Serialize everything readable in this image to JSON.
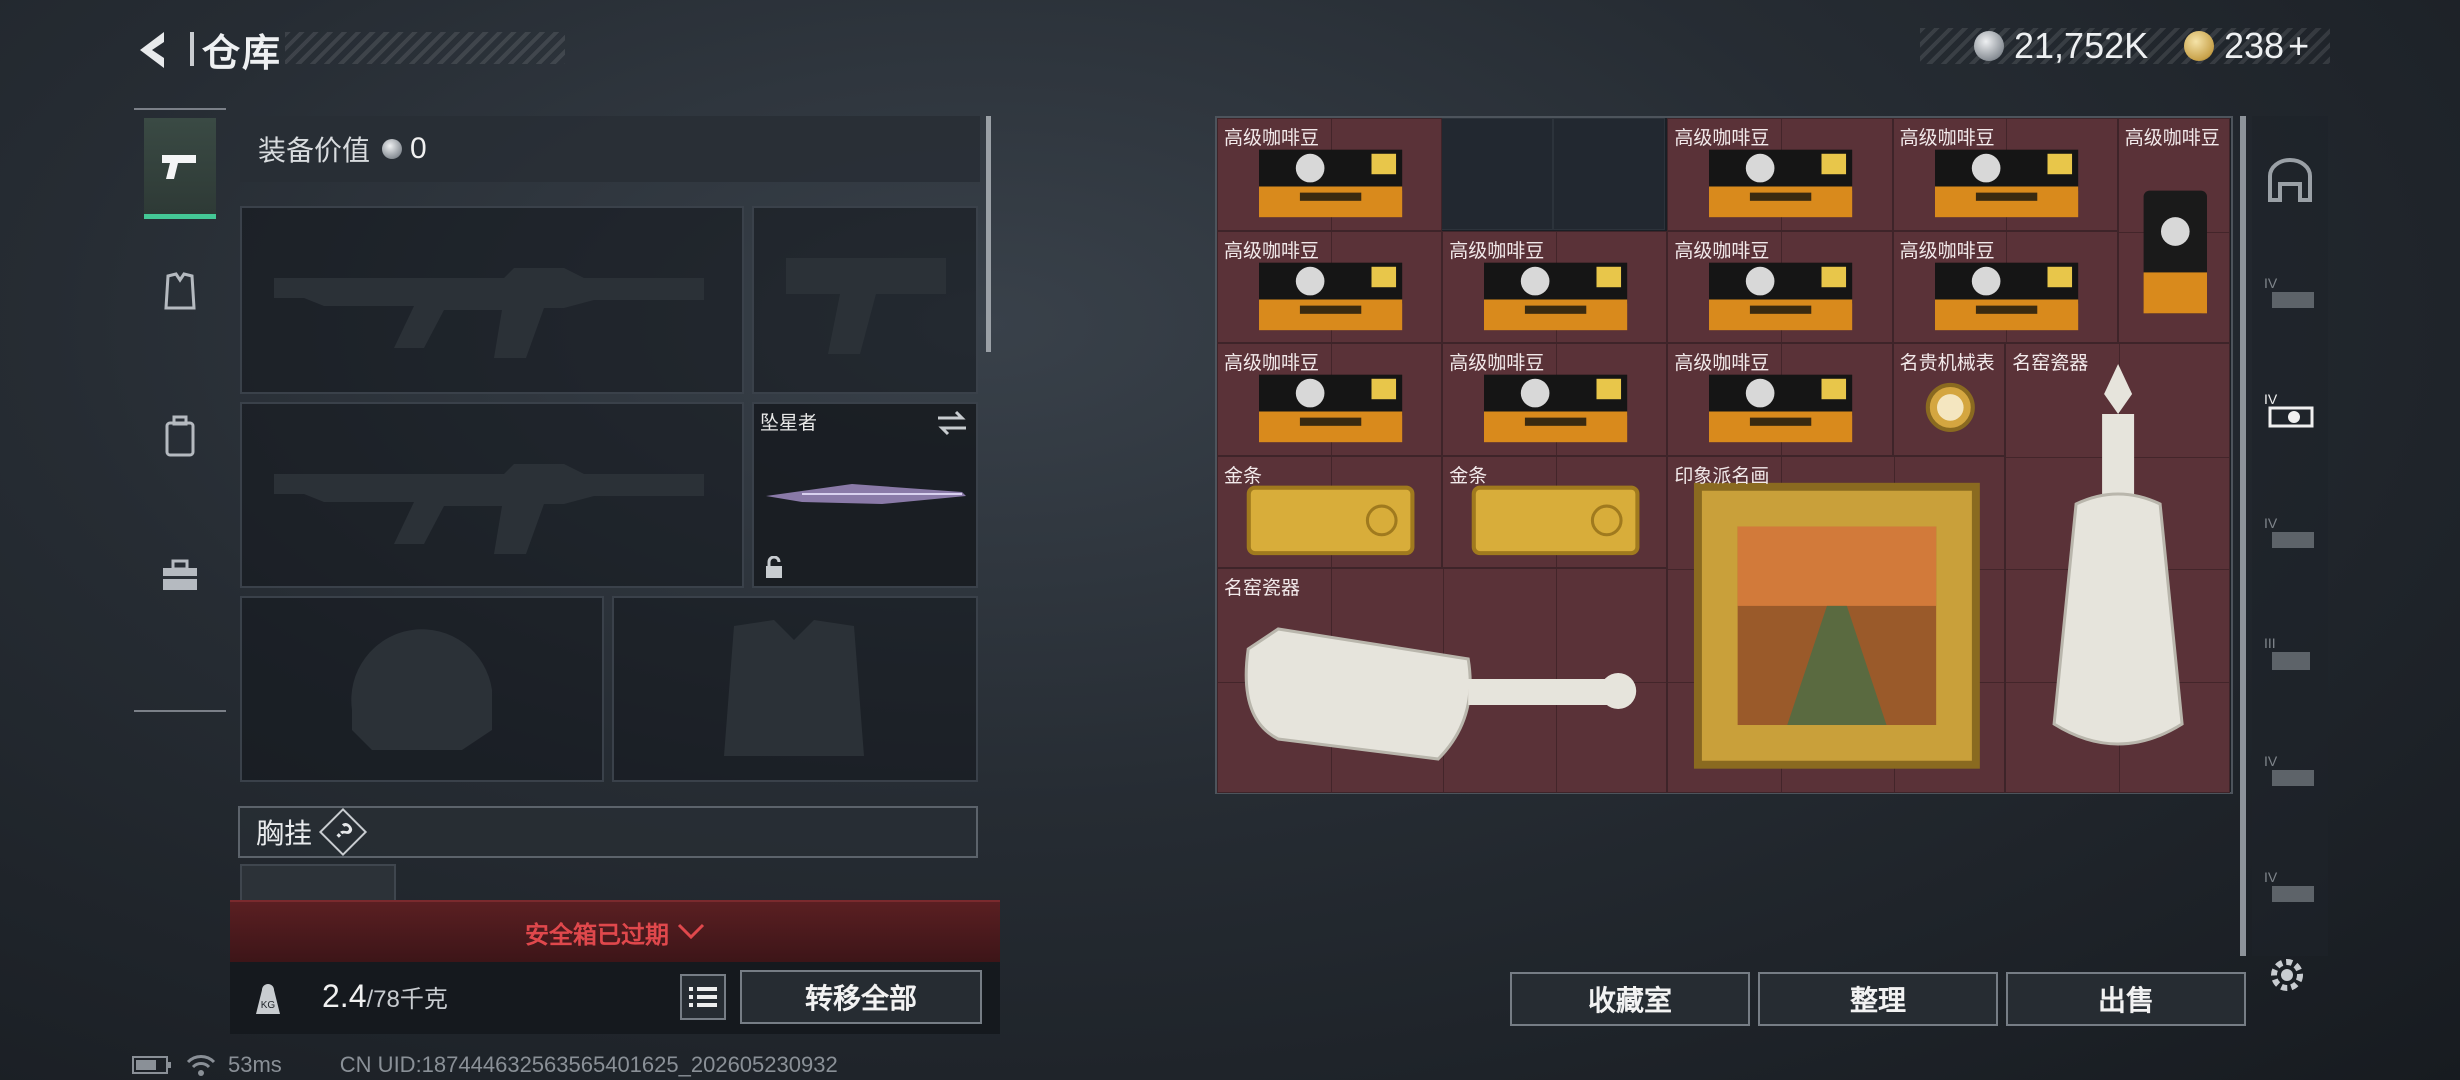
{
  "header": {
    "title": "仓库"
  },
  "currency": {
    "silver": "21,752K",
    "gold": "238"
  },
  "equipment": {
    "value_label": "装备价值",
    "value": "0",
    "melee_name": "坠星者",
    "vest_label": "胸挂",
    "vest_help": "?"
  },
  "safe_box": {
    "text": "安全箱已过期"
  },
  "weight": {
    "current": "2.4",
    "max": "/78千克"
  },
  "buttons": {
    "transfer_all": "转移全部",
    "collection": "收藏室",
    "organize": "整理",
    "sell": "出售"
  },
  "stash_items": [
    {
      "name": "高级咖啡豆"
    },
    {
      "name": "高级咖啡豆"
    },
    {
      "name": "高级咖啡豆"
    },
    {
      "name": "高级咖啡豆"
    },
    {
      "name": "高级咖啡豆"
    },
    {
      "name": "高级咖啡豆"
    },
    {
      "name": "高级咖啡豆"
    },
    {
      "name": "高级咖啡豆"
    },
    {
      "name": "高级咖啡豆"
    },
    {
      "name": "高级咖啡豆"
    },
    {
      "name": "高级咖啡豆"
    },
    {
      "name": "名贵机械表"
    },
    {
      "name": "名窑瓷器"
    },
    {
      "name": "金条"
    },
    {
      "name": "金条"
    },
    {
      "name": "印象派名画"
    },
    {
      "name": "名窑瓷器"
    }
  ],
  "status": {
    "ping": "53ms",
    "uid": "CN UID:1874446325635654016​25_202605230932"
  },
  "colors": {
    "accent_green": "#44c896",
    "expired_red": "#e0484c",
    "stash_cell": "#5a3238"
  }
}
